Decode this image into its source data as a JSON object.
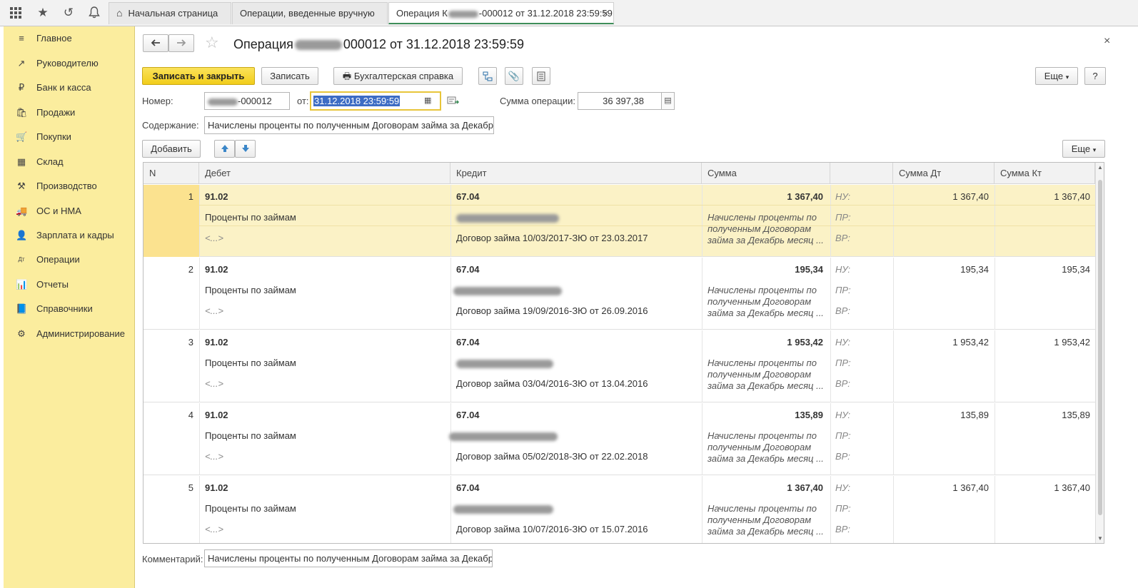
{
  "topbar": {
    "tabs": [
      {
        "label": "Начальная страница"
      },
      {
        "label": "Операции, введенные вручную"
      },
      {
        "label_pre": "Операция К",
        "label_post": "-000012 от 31.12.2018 23:59:59",
        "close": "×"
      }
    ]
  },
  "sidebar": {
    "items": [
      {
        "icon": "≡",
        "label": "Главное"
      },
      {
        "icon": "↗",
        "label": "Руководителю"
      },
      {
        "icon": "₽",
        "label": "Банк и касса"
      },
      {
        "icon": "🛍",
        "label": "Продажи"
      },
      {
        "icon": "🛒",
        "label": "Покупки"
      },
      {
        "icon": "▦",
        "label": "Склад"
      },
      {
        "icon": "⚒",
        "label": "Производство"
      },
      {
        "icon": "🚚",
        "label": "ОС и НМА"
      },
      {
        "icon": "👤",
        "label": "Зарплата и кадры"
      },
      {
        "icon": "Дт",
        "label": "Операции"
      },
      {
        "icon": "📊",
        "label": "Отчеты"
      },
      {
        "icon": "📘",
        "label": "Справочники"
      },
      {
        "icon": "⚙",
        "label": "Администрирование"
      }
    ]
  },
  "header": {
    "title_pre": "Операция",
    "title_post": "000012 от 31.12.2018 23:59:59",
    "close": "×"
  },
  "toolbar": {
    "save_close": "Записать и закрыть",
    "save": "Записать",
    "accounting_ref": "Бухгалтерская справка",
    "more": "Еще",
    "help": "?"
  },
  "form": {
    "number_label": "Номер:",
    "number_suffix": "-000012",
    "date_label": "от:",
    "date_value": "31.12.2018 23:59:59",
    "sum_label": "Сумма операции:",
    "sum_value": "36 397,38",
    "content_label": "Содержание:",
    "content_value": "Начислены проценты по полученным Договорам займа за Декабрь",
    "comment_label": "Комментарий:",
    "comment_value": "Начислены проценты по полученным Договорам займа за Декабрь"
  },
  "table_toolbar": {
    "add": "Добавить",
    "more": "Еще"
  },
  "table": {
    "headers": [
      "N",
      "Дебет",
      "Кредит",
      "Сумма",
      "",
      "Сумма Дт",
      "Сумма Кт"
    ],
    "rows": [
      {
        "n": "1",
        "debit": "91.02",
        "debit_sub": "Проценты по займам",
        "debit_sub2": "<...>",
        "credit": "67.04",
        "credit_contract": "Договор займа 10/03/2017-ЗЮ от 23.03.2017",
        "sum": "1 367,40",
        "desc1": "Начислены проценты по",
        "desc2": "полученным Договорам",
        "desc3": "займа за Декабрь месяц ...",
        "nu": "НУ:",
        "pr": "ПР:",
        "vr": "ВР:",
        "sum_dt": "1 367,40",
        "sum_kt": "1 367,40"
      },
      {
        "n": "2",
        "debit": "91.02",
        "debit_sub": "Проценты по займам",
        "debit_sub2": "<...>",
        "credit": "67.04",
        "credit_contract": "Договор займа 19/09/2016-ЗЮ от 26.09.2016",
        "sum": "195,34",
        "desc1": "Начислены проценты по",
        "desc2": "полученным Договорам",
        "desc3": "займа за Декабрь месяц ...",
        "nu": "НУ:",
        "pr": "ПР:",
        "vr": "ВР:",
        "sum_dt": "195,34",
        "sum_kt": "195,34"
      },
      {
        "n": "3",
        "debit": "91.02",
        "debit_sub": "Проценты по займам",
        "debit_sub2": "<...>",
        "credit": "67.04",
        "credit_contract": "Договор займа 03/04/2016-ЗЮ от 13.04.2016",
        "sum": "1 953,42",
        "desc1": "Начислены проценты по",
        "desc2": "полученным Договорам",
        "desc3": "займа за Декабрь месяц ...",
        "nu": "НУ:",
        "pr": "ПР:",
        "vr": "ВР:",
        "sum_dt": "1 953,42",
        "sum_kt": "1 953,42"
      },
      {
        "n": "4",
        "debit": "91.02",
        "debit_sub": "Проценты по займам",
        "debit_sub2": "<...>",
        "credit": "67.04",
        "credit_contract": "Договор займа 05/02/2018-ЗЮ от 22.02.2018",
        "sum": "135,89",
        "desc1": "Начислены проценты по",
        "desc2": "полученным Договорам",
        "desc3": "займа за Декабрь месяц ...",
        "nu": "НУ:",
        "pr": "ПР:",
        "vr": "ВР:",
        "sum_dt": "135,89",
        "sum_kt": "135,89"
      },
      {
        "n": "5",
        "debit": "91.02",
        "debit_sub": "Проценты по займам",
        "debit_sub2": "<...>",
        "credit": "67.04",
        "credit_contract": "Договор займа 10/07/2016-ЗЮ от 15.07.2016",
        "sum": "1 367,40",
        "desc1": "Начислены проценты по",
        "desc2": "полученным Договорам",
        "desc3": "займа за Декабрь месяц ...",
        "nu": "НУ:",
        "pr": "ПР:",
        "vr": "ВР:",
        "sum_dt": "1 367,40",
        "sum_kt": "1 367,40"
      }
    ]
  }
}
